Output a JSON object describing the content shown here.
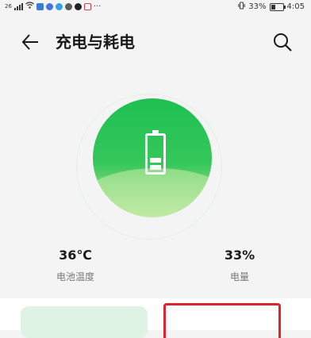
{
  "status_bar": {
    "network": "26",
    "more": "···",
    "battery_percent": "33%",
    "time": "4:05"
  },
  "header": {
    "title": "充电与耗电"
  },
  "battery": {
    "level_fraction": 0.33,
    "color": "#2fc45a"
  },
  "stats": {
    "temperature_value": "36℃",
    "temperature_label": "电池温度",
    "level_value": "33%",
    "level_label": "电量"
  }
}
